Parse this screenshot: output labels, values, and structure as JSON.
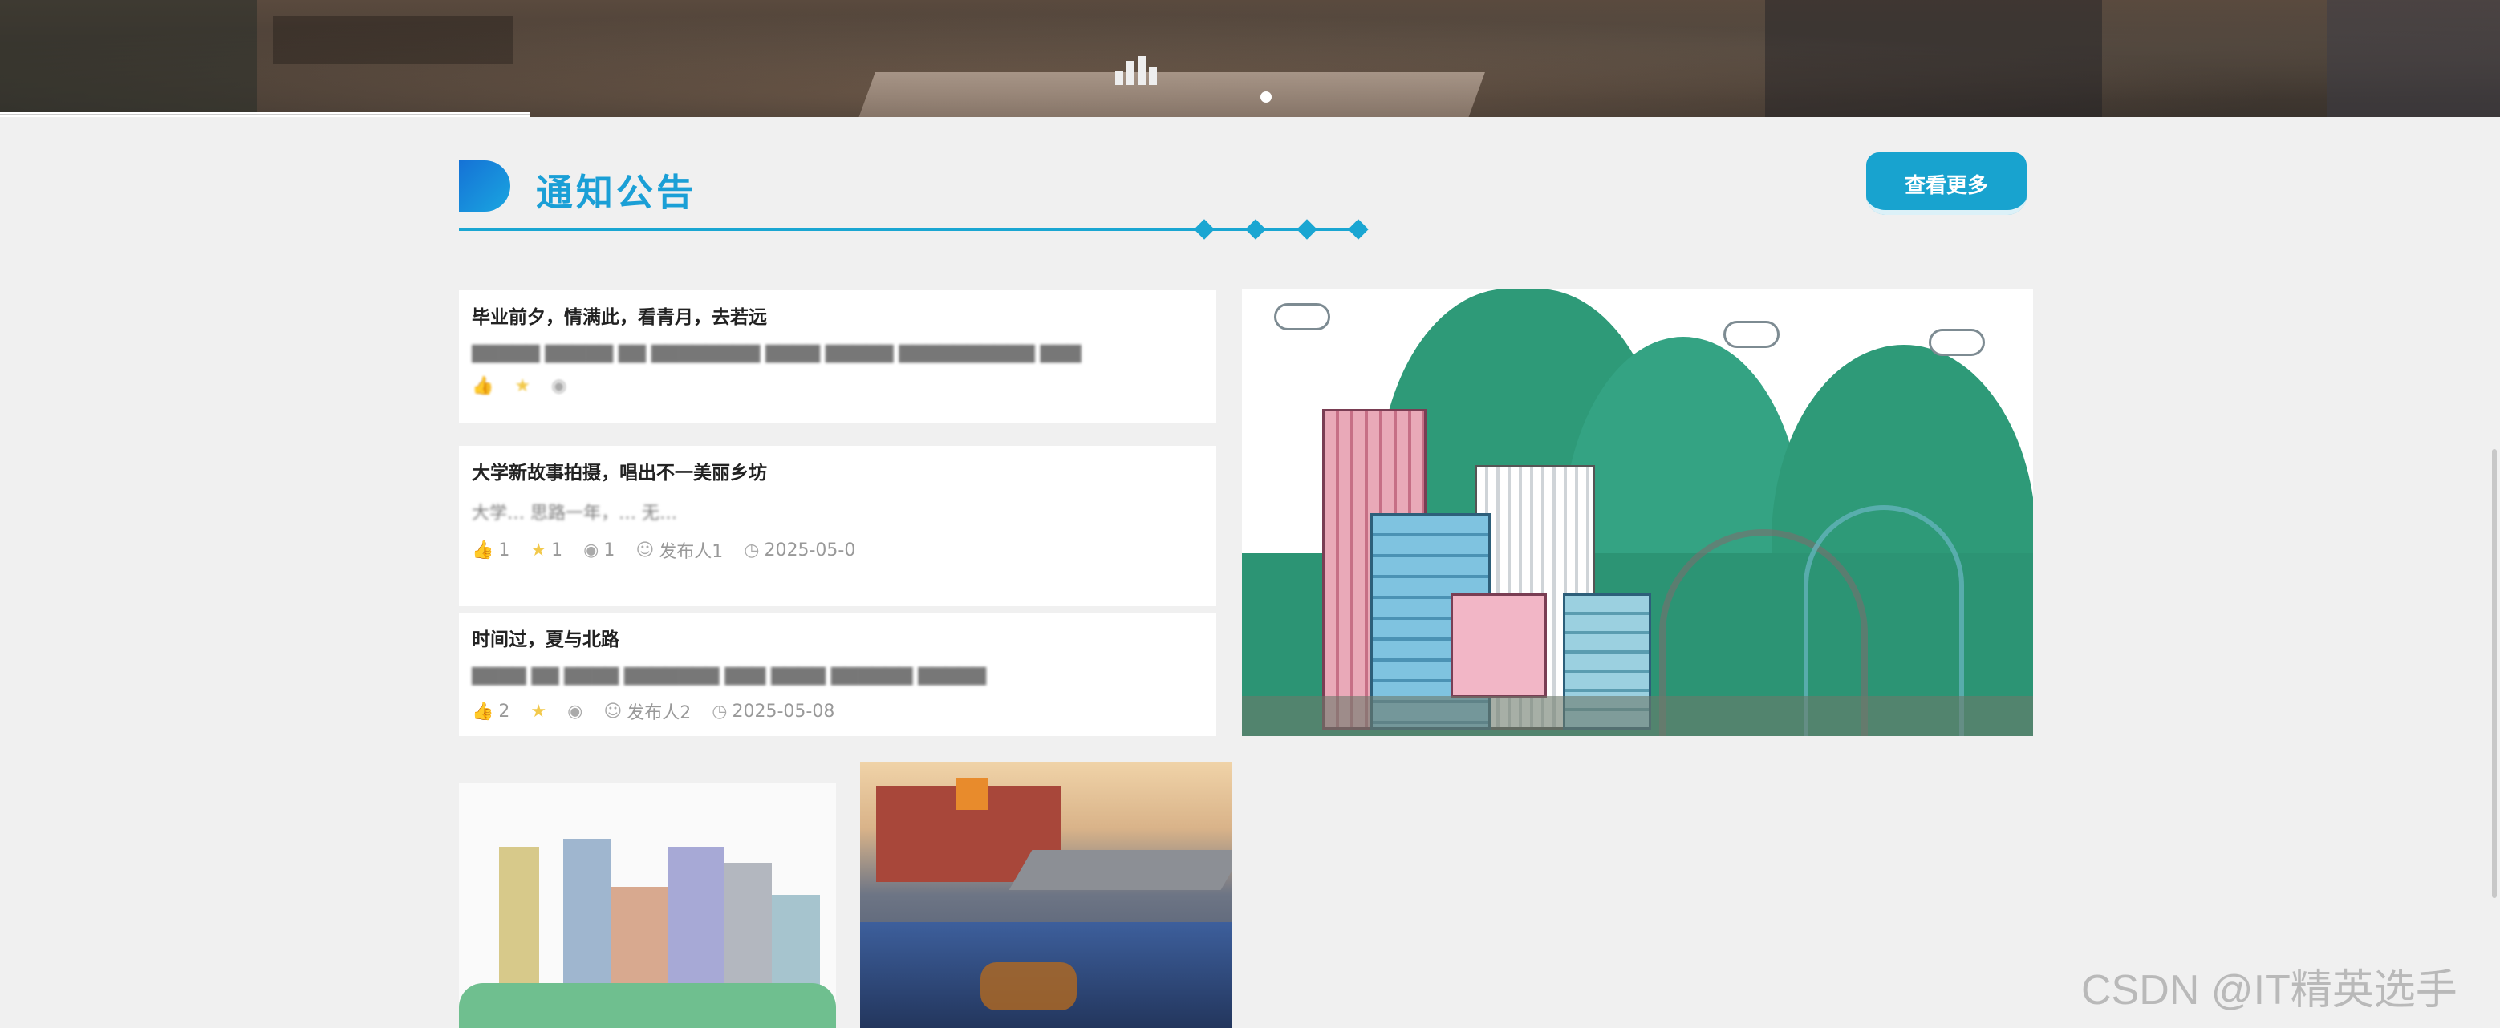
{
  "banner": {
    "logo_text": "",
    "slide_indicator": "1"
  },
  "section": {
    "title": "通知公告",
    "more_button": "查看更多"
  },
  "notices": [
    {
      "title": "毕业前夕，情满此，看青月，去若远",
      "summary": "",
      "likes": "",
      "favorites": "",
      "views": "",
      "author": "",
      "date": ""
    },
    {
      "title": "大学新故事拍摄，唱出不一美丽乡坊",
      "summary": "大学… 思路一年，… 无…",
      "likes": "1",
      "favorites": "1",
      "views": "1",
      "author": "发布人1",
      "date": "2025-05-0"
    },
    {
      "title": "时间过，夏与北路",
      "summary": "",
      "likes": "2",
      "favorites": "",
      "views": "",
      "author": "发布人2",
      "date": "2025-05-08"
    }
  ],
  "watermark": "CSDN @IT精英选手",
  "colors": {
    "accent": "#1aa6d2",
    "title": "#1a9fd6",
    "hill": "#2e9a78"
  }
}
